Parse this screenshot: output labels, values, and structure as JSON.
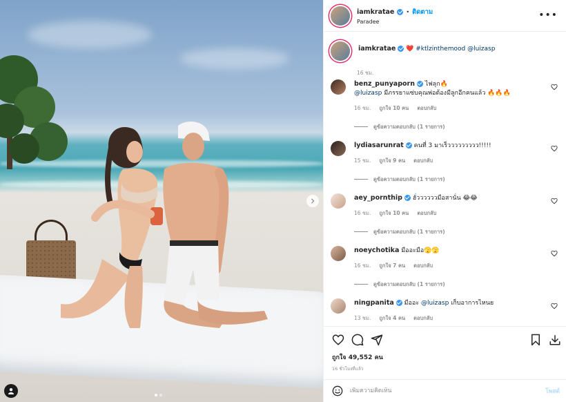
{
  "post_header": {
    "username": "iamkratae",
    "separator": "•",
    "follow_label": "ติดตาม",
    "location": "Paradee",
    "more_icon": "more-horizontal-icon"
  },
  "caption": {
    "username": "iamkratae",
    "emoji": "❤️",
    "hashtag": "#ktlzinthemood",
    "mention": "@luizasp",
    "time": "16 ชม."
  },
  "comments": [
    {
      "username": "benz_punyaporn",
      "verified": true,
      "text": "ไฟลุก🔥",
      "mention": "@luizasp",
      "text2": "มีภรรยาแซ่บคุณพ่อต้องมีลูกอีกคนแล้ว 🔥🔥🔥",
      "time": "16 ชม.",
      "likes": "ถูกใจ 10 คน",
      "reply": "ตอบกลับ",
      "view_replies": "ดูข้อความตอบกลับ (1 รายการ)"
    },
    {
      "username": "lydiasarunrat",
      "verified": true,
      "text": "คนที่ 3 มาเร็ววววววววว!!!!!",
      "time": "15 ชม.",
      "likes": "ถูกใจ 9 คน",
      "reply": "ตอบกลับ",
      "view_replies": "ดูข้อความตอบกลับ (1 รายการ)"
    },
    {
      "username": "aey_pornthip",
      "verified": true,
      "text": "ฮั่ววววววมือสานั่น 😂😂",
      "time": "16 ชม.",
      "likes": "ถูกใจ 10 คน",
      "reply": "ตอบกลับ",
      "view_replies": "ดูข้อความตอบกลับ (1 รายการ)"
    },
    {
      "username": "noeychotika",
      "verified": false,
      "text": "มืออะมือ🫣🫣",
      "time": "16 ชม.",
      "likes": "ถูกใจ 7 คน",
      "reply": "ตอบกลับ",
      "view_replies": "ดูข้อความตอบกลับ (1 รายการ)"
    },
    {
      "username": "ningpanita",
      "verified": true,
      "text": "มืออะ",
      "mention": "@luizasp",
      "text2": "เก็บอาการไหนย",
      "time": "13 ชม.",
      "likes": "ถูกใจ 4 คน",
      "reply": "ตอบกลับ"
    }
  ],
  "likes_count": "ถูกใจ 49,552 คน",
  "post_time": "16 ชั่วโมงที่แล้ว",
  "add_comment": {
    "placeholder": "เพิ่มความคิดเห็น",
    "post_label": "โพสต์"
  },
  "colors": {
    "link_blue": "#0095f6",
    "mention": "#00376b",
    "story_ring": "#e1306c",
    "verified": "#3897f0"
  }
}
